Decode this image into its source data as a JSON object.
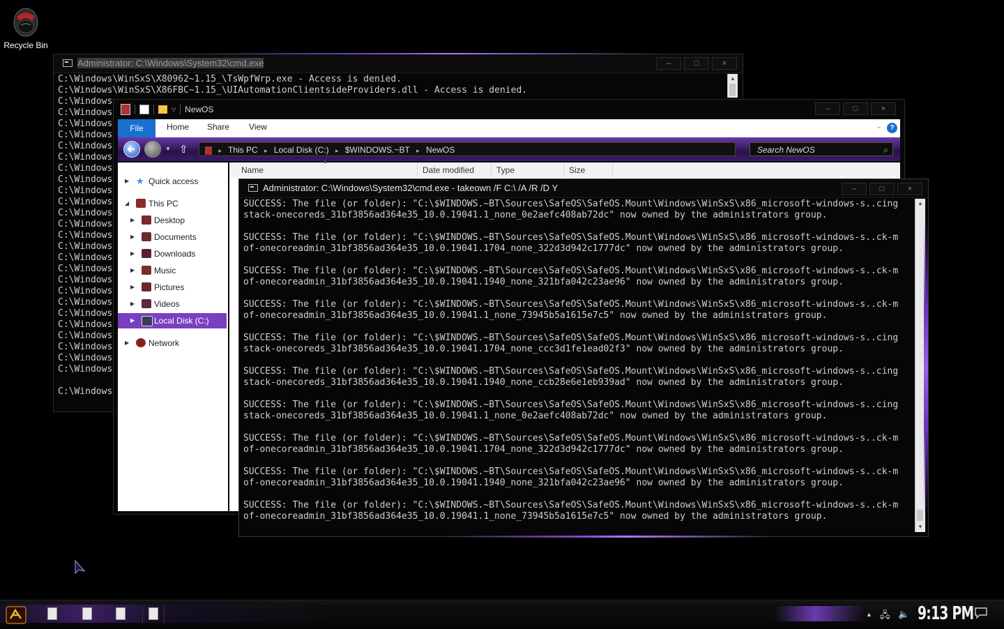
{
  "desktop": {
    "recycle_bin_label": "Recycle Bin"
  },
  "cmd_back": {
    "title": "Administrator: C:\\Windows\\System32\\cmd.exe",
    "lines": [
      "C:\\Windows\\WinSxS\\X80962~1.15_\\TsWpfWrp.exe - Access is denied.",
      "C:\\Windows\\WinSxS\\X86FBC~1.15_\\UIAutomationClientsideProviders.dll - Access is denied.",
      "C:\\Windows",
      "C:\\Windows",
      "C:\\Windows",
      "C:\\Windows",
      "C:\\Windows",
      "C:\\Windows",
      "C:\\Windows",
      "C:\\Windows",
      "C:\\Windows",
      "C:\\Windows",
      "C:\\Windows",
      "C:\\Windows",
      "C:\\Windows",
      "C:\\Windows",
      "C:\\Windows",
      "C:\\Windows",
      "C:\\Windows",
      "C:\\Windows",
      "C:\\Windows",
      "C:\\Windows",
      "C:\\Windows",
      "C:\\Windows",
      "C:\\Windows",
      "C:\\Windows",
      "C:\\Windows",
      "",
      "C:\\Windows"
    ]
  },
  "explorer": {
    "title": "NewOS",
    "ribbon_tabs": {
      "file": "File",
      "home": "Home",
      "share": "Share",
      "view": "View"
    },
    "breadcrumbs": [
      "This PC",
      "Local Disk (C:)",
      "$WINDOWS.~BT",
      "NewOS"
    ],
    "search_placeholder": "Search NewOS",
    "columns": {
      "name": "Name",
      "date_modified": "Date modified",
      "type": "Type",
      "size": "Size"
    },
    "nav": {
      "quick_access": "Quick access",
      "this_pc": "This PC",
      "desktop": "Desktop",
      "documents": "Documents",
      "downloads": "Downloads",
      "music": "Music",
      "pictures": "Pictures",
      "videos": "Videos",
      "local_disk": "Local Disk (C:)",
      "network": "Network"
    }
  },
  "cmd_front": {
    "title": "Administrator: C:\\Windows\\System32\\cmd.exe - takeown  /F C:\\ /A /R /D Y",
    "entries": [
      [
        "SUCCESS: The file (or folder): \"C:\\$WINDOWS.~BT\\Sources\\SafeOS\\SafeOS.Mount\\Windows\\WinSxS\\x86_microsoft-windows-s..cing",
        "stack-onecoreds_31bf3856ad364e35_10.0.19041.1_none_0e2aefc408ab72dc\" now owned by the administrators group."
      ],
      [
        "SUCCESS: The file (or folder): \"C:\\$WINDOWS.~BT\\Sources\\SafeOS\\SafeOS.Mount\\Windows\\WinSxS\\x86_microsoft-windows-s..ck-m",
        "of-onecoreadmin_31bf3856ad364e35_10.0.19041.1704_none_322d3d942c1777dc\" now owned by the administrators group."
      ],
      [
        "SUCCESS: The file (or folder): \"C:\\$WINDOWS.~BT\\Sources\\SafeOS\\SafeOS.Mount\\Windows\\WinSxS\\x86_microsoft-windows-s..ck-m",
        "of-onecoreadmin_31bf3856ad364e35_10.0.19041.1940_none_321bfa042c23ae96\" now owned by the administrators group."
      ],
      [
        "SUCCESS: The file (or folder): \"C:\\$WINDOWS.~BT\\Sources\\SafeOS\\SafeOS.Mount\\Windows\\WinSxS\\x86_microsoft-windows-s..ck-m",
        "of-onecoreadmin_31bf3856ad364e35_10.0.19041.1_none_73945b5a1615e7c5\" now owned by the administrators group."
      ],
      [
        "SUCCESS: The file (or folder): \"C:\\$WINDOWS.~BT\\Sources\\SafeOS\\SafeOS.Mount\\Windows\\WinSxS\\x86_microsoft-windows-s..cing",
        "stack-onecoreds_31bf3856ad364e35_10.0.19041.1704_none_ccc3d1fe1ead02f3\" now owned by the administrators group."
      ],
      [
        "SUCCESS: The file (or folder): \"C:\\$WINDOWS.~BT\\Sources\\SafeOS\\SafeOS.Mount\\Windows\\WinSxS\\x86_microsoft-windows-s..cing",
        "stack-onecoreds_31bf3856ad364e35_10.0.19041.1940_none_ccb28e6e1eb939ad\" now owned by the administrators group."
      ],
      [
        "SUCCESS: The file (or folder): \"C:\\$WINDOWS.~BT\\Sources\\SafeOS\\SafeOS.Mount\\Windows\\WinSxS\\x86_microsoft-windows-s..cing",
        "stack-onecoreds_31bf3856ad364e35_10.0.19041.1_none_0e2aefc408ab72dc\" now owned by the administrators group."
      ],
      [
        "SUCCESS: The file (or folder): \"C:\\$WINDOWS.~BT\\Sources\\SafeOS\\SafeOS.Mount\\Windows\\WinSxS\\x86_microsoft-windows-s..ck-m",
        "of-onecoreadmin_31bf3856ad364e35_10.0.19041.1704_none_322d3d942c1777dc\" now owned by the administrators group."
      ],
      [
        "SUCCESS: The file (or folder): \"C:\\$WINDOWS.~BT\\Sources\\SafeOS\\SafeOS.Mount\\Windows\\WinSxS\\x86_microsoft-windows-s..ck-m",
        "of-onecoreadmin_31bf3856ad364e35_10.0.19041.1940_none_321bfa042c23ae96\" now owned by the administrators group."
      ],
      [
        "SUCCESS: The file (or folder): \"C:\\$WINDOWS.~BT\\Sources\\SafeOS\\SafeOS.Mount\\Windows\\WinSxS\\x86_microsoft-windows-s..ck-m",
        "of-onecoreadmin_31bf3856ad364e35_10.0.19041.1_none_73945b5a1615e7c5\" now owned by the administrators group."
      ]
    ]
  },
  "taskbar": {
    "clock": "9:13 PM"
  },
  "colors": {
    "accent_purple": "#7a3fc0",
    "file_tab_blue": "#1a6fd0"
  }
}
